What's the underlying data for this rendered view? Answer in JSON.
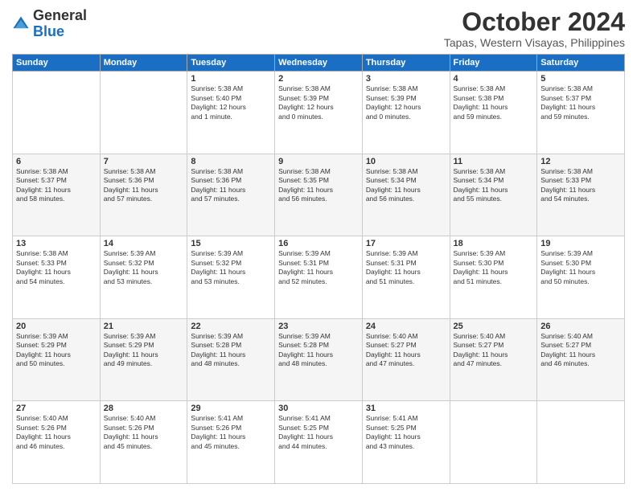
{
  "header": {
    "logo_general": "General",
    "logo_blue": "Blue",
    "month_title": "October 2024",
    "location": "Tapas, Western Visayas, Philippines"
  },
  "weekdays": [
    "Sunday",
    "Monday",
    "Tuesday",
    "Wednesday",
    "Thursday",
    "Friday",
    "Saturday"
  ],
  "weeks": [
    [
      {
        "day": "",
        "info": ""
      },
      {
        "day": "",
        "info": ""
      },
      {
        "day": "1",
        "info": "Sunrise: 5:38 AM\nSunset: 5:40 PM\nDaylight: 12 hours\nand 1 minute."
      },
      {
        "day": "2",
        "info": "Sunrise: 5:38 AM\nSunset: 5:39 PM\nDaylight: 12 hours\nand 0 minutes."
      },
      {
        "day": "3",
        "info": "Sunrise: 5:38 AM\nSunset: 5:39 PM\nDaylight: 12 hours\nand 0 minutes."
      },
      {
        "day": "4",
        "info": "Sunrise: 5:38 AM\nSunset: 5:38 PM\nDaylight: 11 hours\nand 59 minutes."
      },
      {
        "day": "5",
        "info": "Sunrise: 5:38 AM\nSunset: 5:37 PM\nDaylight: 11 hours\nand 59 minutes."
      }
    ],
    [
      {
        "day": "6",
        "info": "Sunrise: 5:38 AM\nSunset: 5:37 PM\nDaylight: 11 hours\nand 58 minutes."
      },
      {
        "day": "7",
        "info": "Sunrise: 5:38 AM\nSunset: 5:36 PM\nDaylight: 11 hours\nand 57 minutes."
      },
      {
        "day": "8",
        "info": "Sunrise: 5:38 AM\nSunset: 5:36 PM\nDaylight: 11 hours\nand 57 minutes."
      },
      {
        "day": "9",
        "info": "Sunrise: 5:38 AM\nSunset: 5:35 PM\nDaylight: 11 hours\nand 56 minutes."
      },
      {
        "day": "10",
        "info": "Sunrise: 5:38 AM\nSunset: 5:34 PM\nDaylight: 11 hours\nand 56 minutes."
      },
      {
        "day": "11",
        "info": "Sunrise: 5:38 AM\nSunset: 5:34 PM\nDaylight: 11 hours\nand 55 minutes."
      },
      {
        "day": "12",
        "info": "Sunrise: 5:38 AM\nSunset: 5:33 PM\nDaylight: 11 hours\nand 54 minutes."
      }
    ],
    [
      {
        "day": "13",
        "info": "Sunrise: 5:38 AM\nSunset: 5:33 PM\nDaylight: 11 hours\nand 54 minutes."
      },
      {
        "day": "14",
        "info": "Sunrise: 5:39 AM\nSunset: 5:32 PM\nDaylight: 11 hours\nand 53 minutes."
      },
      {
        "day": "15",
        "info": "Sunrise: 5:39 AM\nSunset: 5:32 PM\nDaylight: 11 hours\nand 53 minutes."
      },
      {
        "day": "16",
        "info": "Sunrise: 5:39 AM\nSunset: 5:31 PM\nDaylight: 11 hours\nand 52 minutes."
      },
      {
        "day": "17",
        "info": "Sunrise: 5:39 AM\nSunset: 5:31 PM\nDaylight: 11 hours\nand 51 minutes."
      },
      {
        "day": "18",
        "info": "Sunrise: 5:39 AM\nSunset: 5:30 PM\nDaylight: 11 hours\nand 51 minutes."
      },
      {
        "day": "19",
        "info": "Sunrise: 5:39 AM\nSunset: 5:30 PM\nDaylight: 11 hours\nand 50 minutes."
      }
    ],
    [
      {
        "day": "20",
        "info": "Sunrise: 5:39 AM\nSunset: 5:29 PM\nDaylight: 11 hours\nand 50 minutes."
      },
      {
        "day": "21",
        "info": "Sunrise: 5:39 AM\nSunset: 5:29 PM\nDaylight: 11 hours\nand 49 minutes."
      },
      {
        "day": "22",
        "info": "Sunrise: 5:39 AM\nSunset: 5:28 PM\nDaylight: 11 hours\nand 48 minutes."
      },
      {
        "day": "23",
        "info": "Sunrise: 5:39 AM\nSunset: 5:28 PM\nDaylight: 11 hours\nand 48 minutes."
      },
      {
        "day": "24",
        "info": "Sunrise: 5:40 AM\nSunset: 5:27 PM\nDaylight: 11 hours\nand 47 minutes."
      },
      {
        "day": "25",
        "info": "Sunrise: 5:40 AM\nSunset: 5:27 PM\nDaylight: 11 hours\nand 47 minutes."
      },
      {
        "day": "26",
        "info": "Sunrise: 5:40 AM\nSunset: 5:27 PM\nDaylight: 11 hours\nand 46 minutes."
      }
    ],
    [
      {
        "day": "27",
        "info": "Sunrise: 5:40 AM\nSunset: 5:26 PM\nDaylight: 11 hours\nand 46 minutes."
      },
      {
        "day": "28",
        "info": "Sunrise: 5:40 AM\nSunset: 5:26 PM\nDaylight: 11 hours\nand 45 minutes."
      },
      {
        "day": "29",
        "info": "Sunrise: 5:41 AM\nSunset: 5:26 PM\nDaylight: 11 hours\nand 45 minutes."
      },
      {
        "day": "30",
        "info": "Sunrise: 5:41 AM\nSunset: 5:25 PM\nDaylight: 11 hours\nand 44 minutes."
      },
      {
        "day": "31",
        "info": "Sunrise: 5:41 AM\nSunset: 5:25 PM\nDaylight: 11 hours\nand 43 minutes."
      },
      {
        "day": "",
        "info": ""
      },
      {
        "day": "",
        "info": ""
      }
    ]
  ]
}
